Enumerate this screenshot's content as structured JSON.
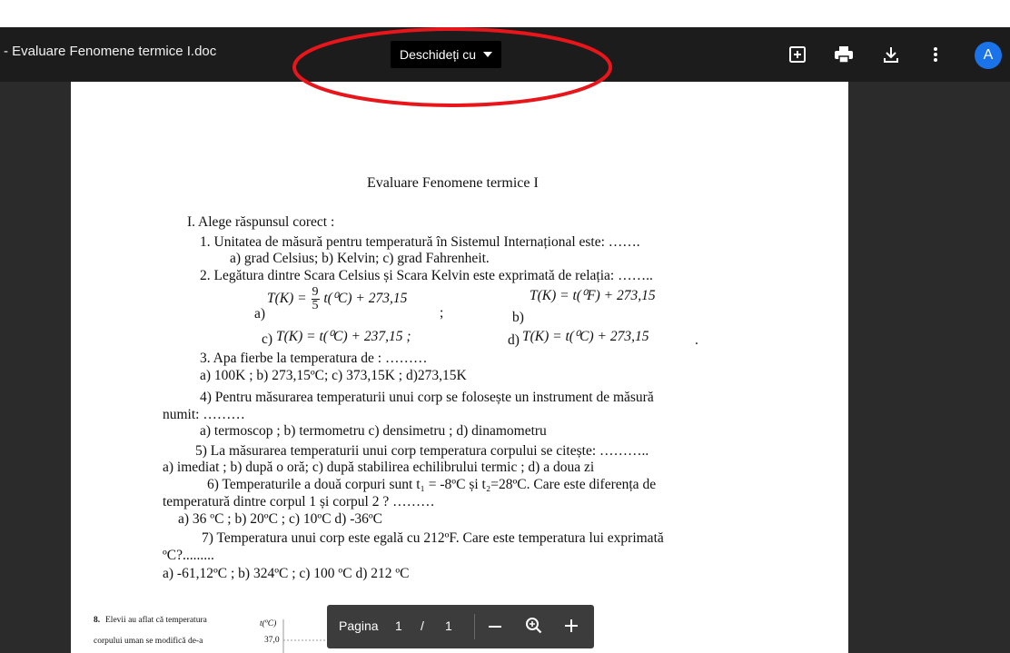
{
  "toolbar": {
    "title": "- Evaluare Fenomene termice I.doc",
    "open_with_label": "Deschideți cu",
    "avatar_letter": "A",
    "icons": [
      "add-comment-icon",
      "print-icon",
      "download-icon",
      "more-vert-icon"
    ]
  },
  "annotation": {
    "color": "#e8151b"
  },
  "document": {
    "title": "Evaluare Fenomene termice I",
    "section": "I. Alege răspunsul corect :",
    "q1": "1. Unitatea de măsură pentru temperatură în Sistemul Internațional este: …….",
    "q1_options": "a) grad Celsius;     b) Kelvin;   c) grad Fahrenheit.",
    "q2": "2. Legătura dintre Scara Celsius și Scara Kelvin este exprimată de relația: ……..",
    "q2a_label": "a)",
    "q2a_lhs": "T(K) =",
    "q2a_num": "9",
    "q2a_den": "5",
    "q2a_rhs": "t(⁰C) + 273,15",
    "q2a_end": ";",
    "q2b_label": "b)",
    "q2b_formula": "T(K) = t(⁰F) + 273,15",
    "q2c_label": "c)",
    "q2c_formula": "T(K) = t(⁰C) + 237,15 ;",
    "q2d_label": "d)",
    "q2d_formula": "T(K) = t(⁰C) + 273,15",
    "q2d_end": ".",
    "q3": "3. Apa fierbe  la temperatura de : ………",
    "q3_options": "a) 100K ;    b) 273,15ºC;    c) 373,15K ;    d)273,15K",
    "q4": "4)    Pentru măsurarea temperaturii unui corp se folosește un instrument de măsură",
    "q4_cont": "numit: ………",
    "q4_options": "a) termoscop ; b) termometru   c) densimetru ;      d) dinamometru",
    "q5": "5)    La măsurarea temperaturii unui corp temperatura corpului  se citește: ………..",
    "q5_options": "a) imediat ; b) după o oră;   c) după stabilirea echilibrului termic ; d) a doua zi",
    "q6": "6) Temperaturile a două corpuri sunt t₁ = -8ºC și t₂=28ºC. Care este diferența de",
    "q6_cont": "temperatură dintre corpul 1 și corpul 2 ? ………",
    "q6_options": "a) 36 ºC ; b) 20ºC ; c) 10ºC d) -36ºC",
    "q7": "7)  Temperatura unui corp este egală cu 212ºF. Care este temperatura lui exprimată",
    "q7_cont": "ºC?.........",
    "q7_options": "a) -61,12ºC ; b) 324ºC ; c) 100 ºC  d) 212 ºC",
    "q8_num": "8.",
    "q8_line1": "Elevii au aflat că temperatura",
    "q8_line2": "corpului uman se modifică de-a",
    "graph_axis_label": "t(ºC)",
    "graph_tick": "37,0"
  },
  "pager": {
    "label": "Pagina",
    "current": "1",
    "separator": "/",
    "total": "1",
    "icons": [
      "zoom-out-icon",
      "zoom-icon",
      "zoom-in-icon"
    ]
  }
}
